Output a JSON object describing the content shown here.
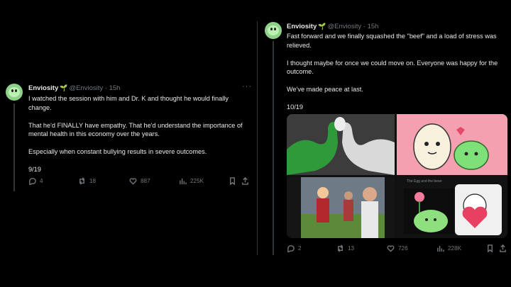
{
  "left_tweet": {
    "display_name": "Enviosity",
    "handle": "@Enviosity",
    "time": "15h",
    "paragraphs": [
      "I watched the session with him and Dr. K and thought he would finally change.",
      "That he'd FINALLY have empathy. That he'd understand the importance of mental health in this economy over the years.",
      "Especially when constant bullying results in severe outcomes.",
      "9/19"
    ],
    "stats": {
      "replies": "4",
      "reposts": "18",
      "likes": "887",
      "views": "225K"
    }
  },
  "right_tweet": {
    "display_name": "Enviosity",
    "handle": "@Enviosity",
    "time": "15h",
    "paragraphs": [
      "Fast forward and we finally squashed the \"beef\" and a load of stress was relieved.",
      "I thought maybe for once we could move on. Everyone was happy for the outcome.",
      "We've made peace at last.",
      "10/19"
    ],
    "media_caption_text": "The Egg and the bean",
    "stats": {
      "replies": "2",
      "reposts": "13",
      "likes": "726",
      "views": "228K"
    }
  },
  "separator": "·",
  "more_label": "···",
  "colors": {
    "background": "#000000",
    "text": "#e7e9ea",
    "muted": "#71767b",
    "divider": "#2f3336",
    "avatar": "#8fd18a"
  },
  "icons": [
    "reply-icon",
    "repost-icon",
    "like-icon",
    "views-icon",
    "bookmark-icon",
    "share-icon",
    "sprout-icon",
    "more-icon"
  ]
}
